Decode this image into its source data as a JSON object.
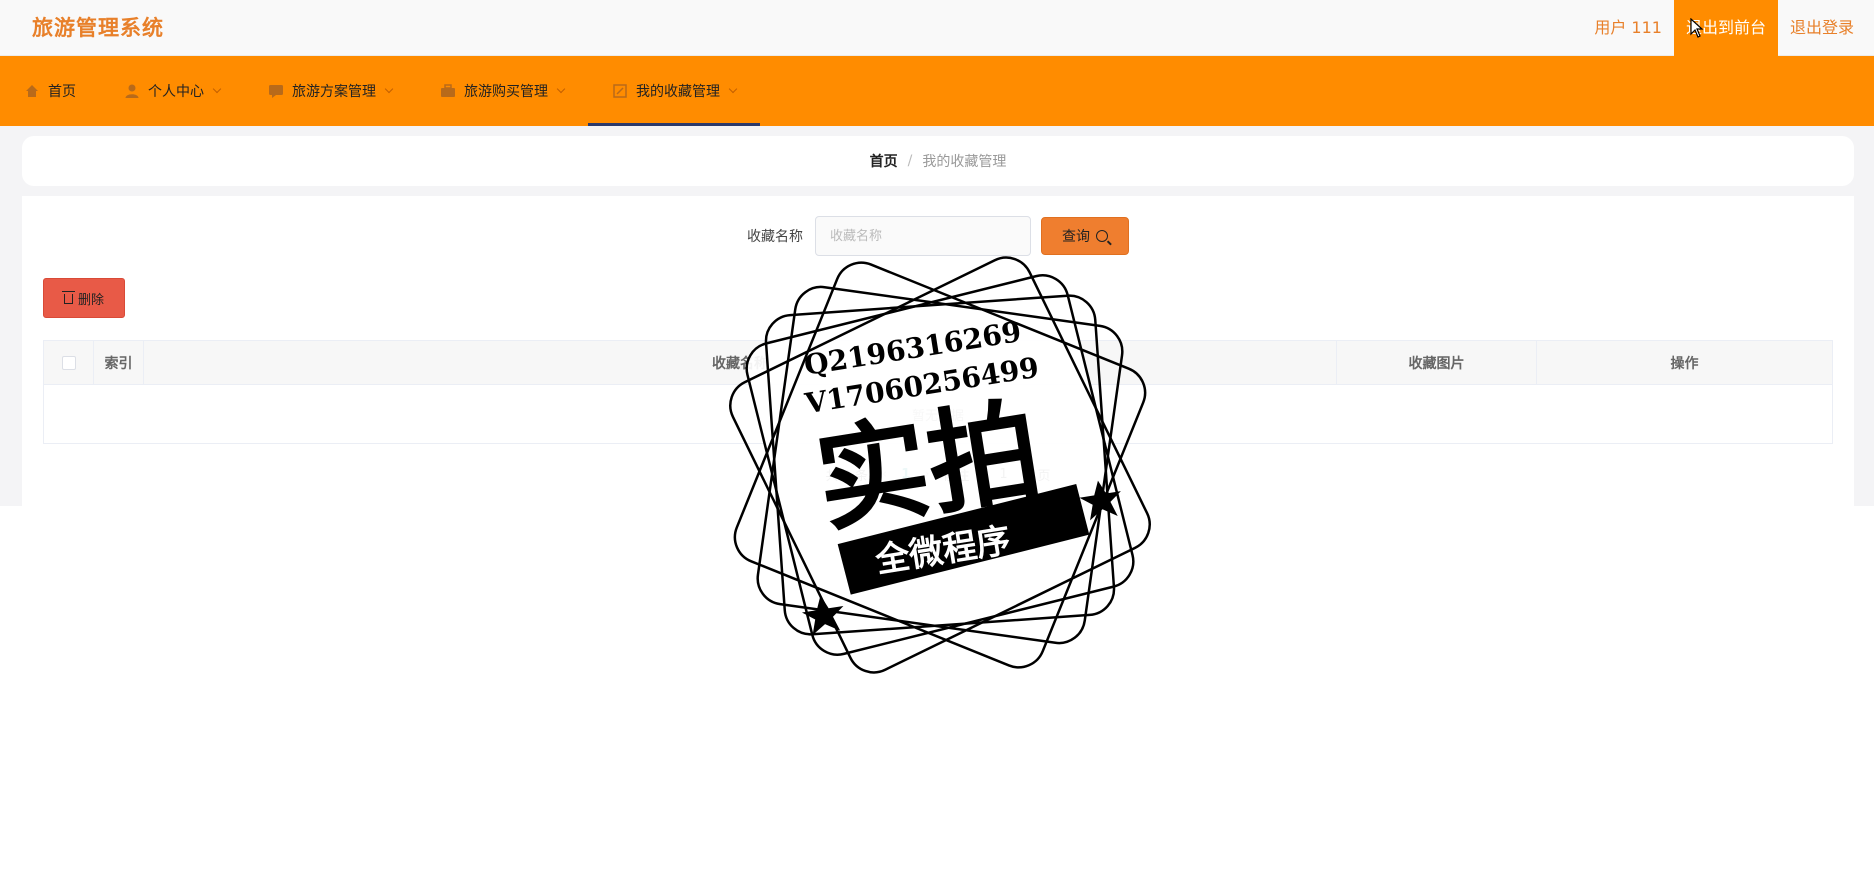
{
  "header": {
    "app_title": "旅游管理系统",
    "user_label": "用户 111",
    "front_button": "退出到前台",
    "logout_button": "退出登录"
  },
  "nav": {
    "items": [
      {
        "label": "首页",
        "icon": "home-icon",
        "has_dropdown": false,
        "active": false
      },
      {
        "label": "个人中心",
        "icon": "user-icon",
        "has_dropdown": true,
        "active": false
      },
      {
        "label": "旅游方案管理",
        "icon": "chat-icon",
        "has_dropdown": true,
        "active": false
      },
      {
        "label": "旅游购买管理",
        "icon": "briefcase-icon",
        "has_dropdown": true,
        "active": false
      },
      {
        "label": "我的收藏管理",
        "icon": "bookmark-icon",
        "has_dropdown": true,
        "active": true
      }
    ]
  },
  "breadcrumb": {
    "home": "首页",
    "separator": "/",
    "current": "我的收藏管理"
  },
  "search": {
    "label": "收藏名称",
    "placeholder": "收藏名称",
    "value": "",
    "button_label": "查询"
  },
  "actions": {
    "delete_label": "删除"
  },
  "table": {
    "columns": [
      "索引",
      "收藏名称",
      "收藏图片",
      "操作"
    ],
    "rows": [],
    "empty_text": "暂无数据"
  },
  "pagination": {
    "total_prefix": "共 0 条",
    "current_page": "1",
    "goto_prefix": "前往",
    "goto_value": "1",
    "goto_suffix": "页"
  },
  "watermark": {
    "line1": "Q2196316269",
    "line2": "V17060256499",
    "main": "实拍",
    "banner": "全微程序"
  },
  "colors": {
    "accent": "#ff8c00",
    "title": "#e8802a",
    "query_button": "#ef7e2f",
    "delete_button": "#e85a47",
    "active_underline": "#2b3a6b"
  }
}
